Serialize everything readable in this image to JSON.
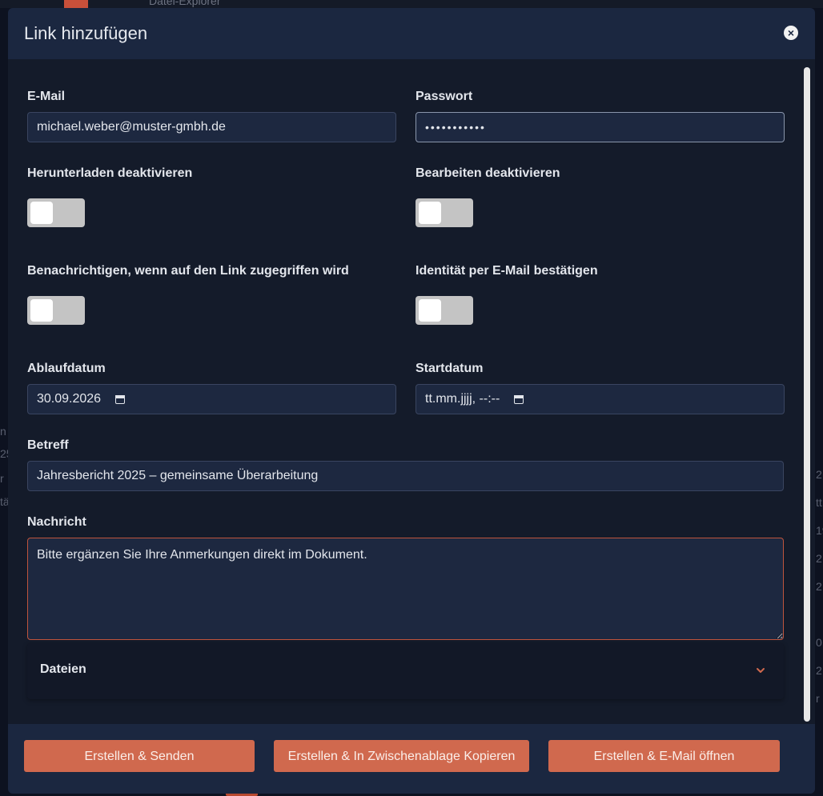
{
  "backdrop": {
    "title": "Datei-Explorer",
    "left_fragments": [
      "n",
      "25",
      "r",
      "tä"
    ],
    "right_fragments": [
      "2",
      "tt",
      "19",
      "2",
      "2",
      "0",
      "2",
      "r"
    ]
  },
  "modal": {
    "title": "Link hinzufügen",
    "close_symbol": "×"
  },
  "form": {
    "email_label": "E-Mail",
    "email_value": "michael.weber@muster-gmbh.de",
    "password_label": "Passwort",
    "password_value": "•••••••••••",
    "disable_download_label": "Herunterladen deaktivieren",
    "disable_download_on": false,
    "disable_edit_label": "Bearbeiten deaktivieren",
    "disable_edit_on": false,
    "notify_label": "Benachrichtigen, wenn auf den Link zugegriffen wird",
    "notify_on": false,
    "verify_identity_label": "Identität per E-Mail bestätigen",
    "verify_identity_on": false,
    "expiry_label": "Ablaufdatum",
    "expiry_value": "30.09.2026",
    "start_label": "Startdatum",
    "start_placeholder": "tt.mm.jjjj, --:--",
    "subject_label": "Betreff",
    "subject_value": "Jahresbericht 2025 – gemeinsame Überarbeitung",
    "message_label": "Nachricht",
    "message_value": "Bitte ergänzen Sie Ihre Anmerkungen direkt im Dokument.",
    "files_label": "Dateien"
  },
  "footer": {
    "send_label": "Erstellen & Senden",
    "copy_label": "Erstellen & In Zwischenablage Kopieren",
    "email_label": "Erstellen & E-Mail öffnen"
  },
  "colors": {
    "accent": "#d0694e",
    "header_bg": "#1b2740",
    "body_bg": "#141b2a",
    "input_bg": "#1d2840"
  },
  "icons": {
    "close": "close-icon",
    "calendar": "calendar-icon",
    "chevron": "chevron-down-icon"
  }
}
